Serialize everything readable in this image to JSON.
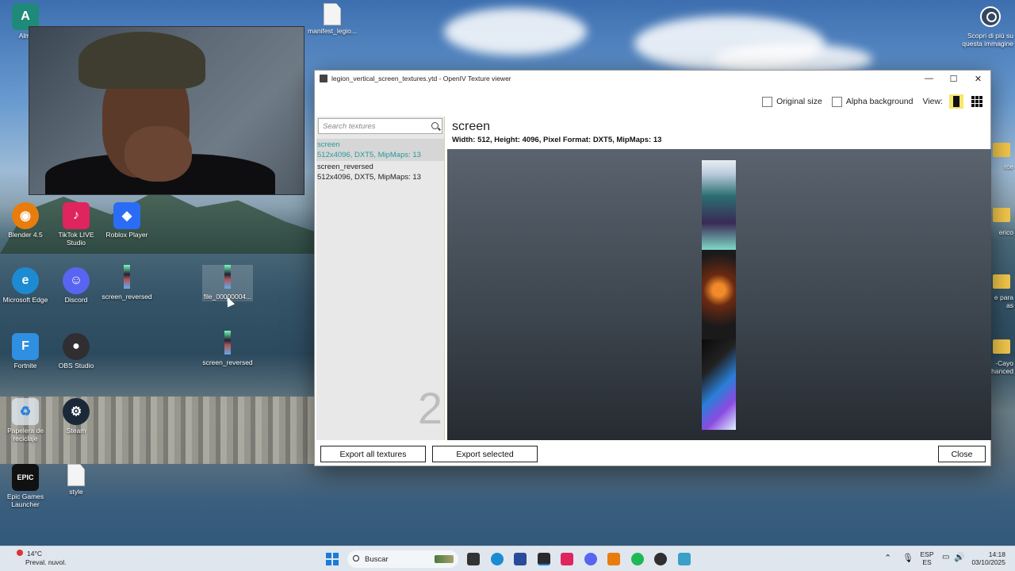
{
  "desktop": {
    "icons": [
      {
        "label": "Almi",
        "color": "#1f8a7a"
      },
      {
        "label": "TikTok LIVE Studio",
        "color": "#e0245e"
      },
      {
        "label": "Roblox Player",
        "color": "#2a6df4"
      },
      {
        "label": "Blender 4.5",
        "color": "#e87d0d"
      },
      {
        "label": "Microsoft Edge",
        "color": "#1d8bd1"
      },
      {
        "label": "Discord",
        "color": "#5865f2"
      },
      {
        "label": "screen_reversed"
      },
      {
        "label": "file_00000004..."
      },
      {
        "label": "Fortnite",
        "color": "#2f8fe0"
      },
      {
        "label": "OBS Studio",
        "color": "#302e31"
      },
      {
        "label": "screen_reversed"
      },
      {
        "label": "Papelera de reciclaje"
      },
      {
        "label": "Steam",
        "color": "#1b2838"
      },
      {
        "label": "Epic Games Launcher",
        "color": "#111111"
      },
      {
        "label": "style"
      },
      {
        "label": "manifest_legio..."
      }
    ],
    "right_labels": [
      "Scopri di più su questa immagine",
      "rce",
      "erico",
      "e para as",
      "-Cayo hanced"
    ]
  },
  "window": {
    "title": "legion_vertical_screen_textures.ytd - OpenIV Texture viewer",
    "controls": {
      "minimize": "—",
      "maximize": "☐",
      "close": "✕"
    },
    "toolbar": {
      "original_size": "Original size",
      "alpha_background": "Alpha background",
      "view_label": "View:"
    },
    "search": {
      "placeholder": "Search textures"
    },
    "textures": [
      {
        "name": "screen",
        "info": "512x4096, DXT5, MipMaps: 13",
        "selected": true
      },
      {
        "name": "screen_reversed",
        "info": "512x4096, DXT5, MipMaps: 13",
        "selected": false
      }
    ],
    "texture_count": "2",
    "selected": {
      "name": "screen",
      "details": "Width: 512, Height: 4096, Pixel Format: DXT5, MipMaps: 13"
    },
    "buttons": {
      "export_all": "Export all textures",
      "export_selected": "Export selected",
      "close": "Close"
    }
  },
  "taskbar": {
    "weather_temp": "14°C",
    "weather_desc": "Preval. nuvol.",
    "search_label": "Buscar",
    "lang_top": "ESP",
    "lang_bottom": "ES",
    "time": "14:18",
    "date": "03/10/2025"
  },
  "colors": {
    "accent_teal": "#2a9a9a",
    "view_active": "#f6e66a",
    "start_blue": "#1b7bd6"
  }
}
